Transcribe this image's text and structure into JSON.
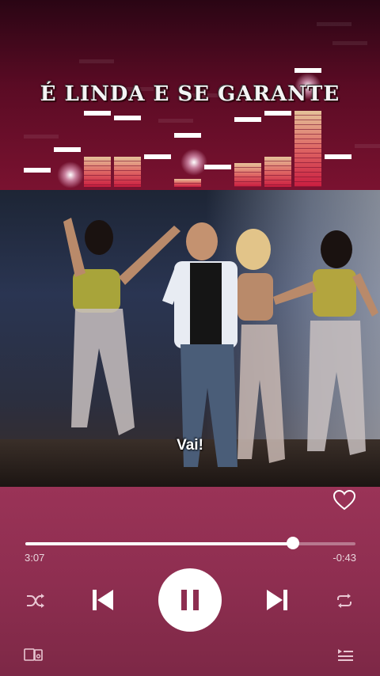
{
  "banner": {
    "title": "É LINDA E SE GARANTE",
    "eq_colors": {
      "bar_top": "#f0d3a8",
      "bar_mid": "#e86a6a",
      "bar_low": "#d1263f",
      "peak": "#ffffff"
    }
  },
  "video": {
    "caption": "Vai!"
  },
  "player": {
    "progress": 0.81,
    "elapsed": "3:07",
    "remaining": "-0:43",
    "state": "playing",
    "icons": {
      "like": "heart-outline-icon",
      "shuffle": "shuffle-icon",
      "previous": "skip-previous-icon",
      "play_pause": "pause-icon",
      "next": "skip-next-icon",
      "repeat": "repeat-icon",
      "devices": "connect-device-icon",
      "queue": "queue-icon"
    },
    "colors": {
      "background": "#8e2e50",
      "accent": "#ffffff"
    }
  }
}
